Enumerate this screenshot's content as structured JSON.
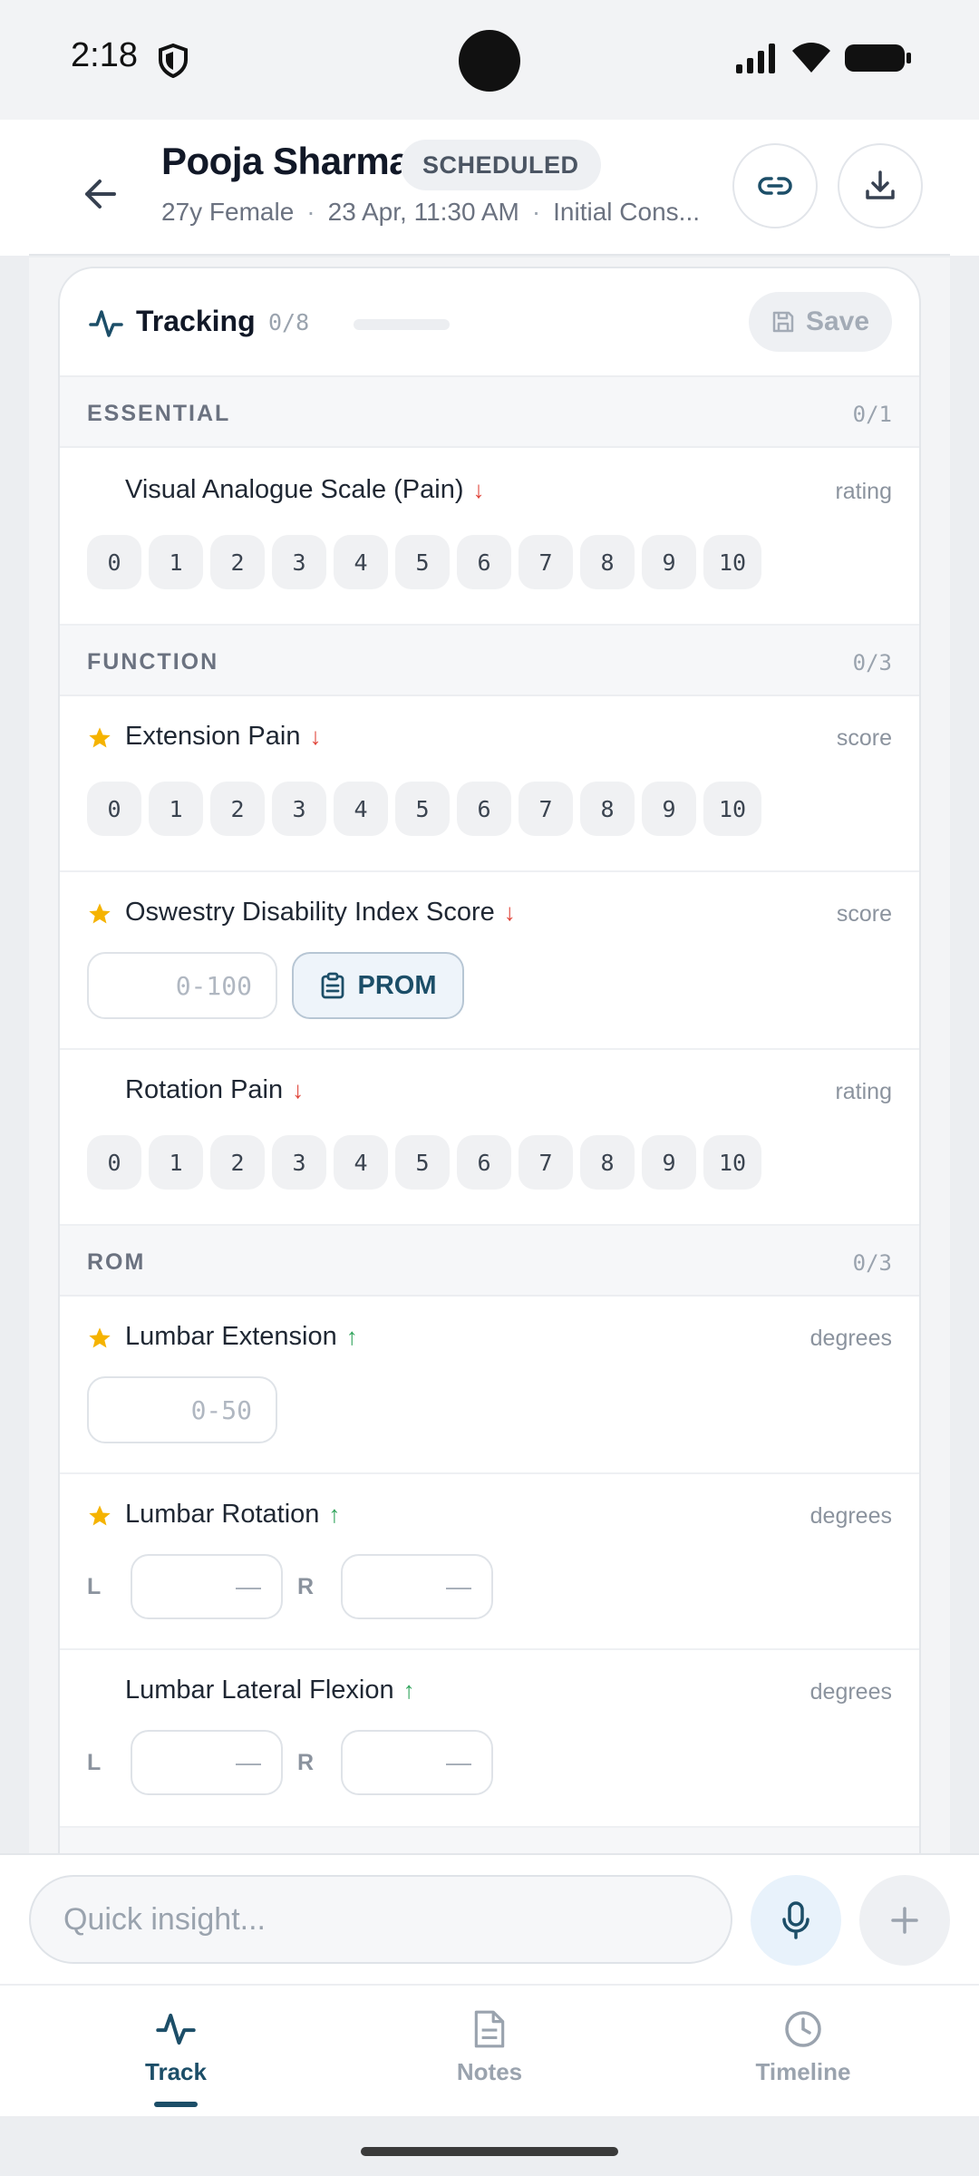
{
  "status_bar": {
    "time": "2:18"
  },
  "header": {
    "patient_name": "Pooja Sharma",
    "status": "SCHEDULED",
    "meta": [
      "27y Female",
      "23 Apr, 11:30 AM",
      "Initial Cons..."
    ],
    "meta_separator": "·"
  },
  "tracking": {
    "title": "Tracking",
    "count": "0/8",
    "progress": 0,
    "save_label": "Save"
  },
  "sections": {
    "essential": {
      "title": "ESSENTIAL",
      "count": "0/1",
      "vas": {
        "name": "Visual Analogue Scale (Pain)",
        "unit": "rating",
        "direction": "↓"
      }
    },
    "function": {
      "title": "FUNCTION",
      "count": "0/3",
      "extension": {
        "name": "Extension Pain",
        "unit": "score",
        "direction": "↓",
        "starred": true
      },
      "odi": {
        "name": "Oswestry Disability Index Score",
        "unit": "score",
        "direction": "↓",
        "starred": true,
        "placeholder": "0-100",
        "prom_label": "PROM"
      },
      "rotation": {
        "name": "Rotation Pain",
        "unit": "rating",
        "direction": "↓"
      }
    },
    "rom": {
      "title": "ROM",
      "count": "0/3",
      "lumbar_extension": {
        "name": "Lumbar Extension",
        "unit": "degrees",
        "direction": "↑",
        "starred": true,
        "placeholder": "0-50"
      },
      "lumbar_rotation": {
        "name": "Lumbar Rotation",
        "unit": "degrees",
        "direction": "↑",
        "starred": true,
        "left_label": "L",
        "right_label": "R",
        "left_value": "—",
        "right_value": "—"
      },
      "lumbar_lateral_flexion": {
        "name": "Lumbar Lateral Flexion",
        "unit": "degrees",
        "direction": "↑",
        "left_label": "L",
        "right_label": "R",
        "left_value": "—",
        "right_value": "—"
      }
    }
  },
  "scale_values": [
    "0",
    "1",
    "2",
    "3",
    "4",
    "5",
    "6",
    "7",
    "8",
    "9",
    "10"
  ],
  "insight": {
    "placeholder": "Quick insight..."
  },
  "nav": {
    "track": "Track",
    "notes": "Notes",
    "timeline": "Timeline",
    "active": "Track"
  },
  "colors": {
    "accent": "#1c4e68",
    "star": "#f5b300",
    "down": "#e0453a",
    "up": "#2ea35a"
  }
}
